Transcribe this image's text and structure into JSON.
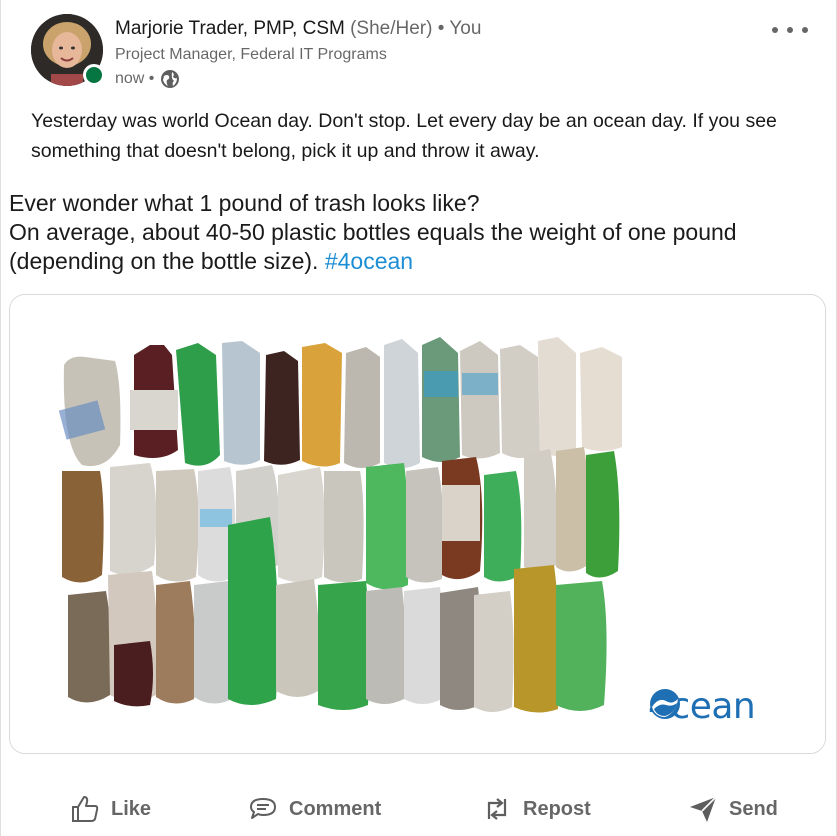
{
  "post": {
    "author": {
      "name": "Marjorie Trader, PMP, CSM",
      "pronouns": "(She/Her)",
      "degree": "• You",
      "headline": "Project Manager, Federal IT Programs",
      "time": "now •",
      "visibility_icon": "globe-icon",
      "presence_color": "#057642"
    },
    "commentary": "Yesterday was world Ocean day. Don't stop. Let every day be an ocean day. If you see something that doesn't belong, pick it up and throw it away.",
    "embedded_text": {
      "line1": "Ever wonder what 1 pound of trash looks like?",
      "line2": "On average, about 40-50 plastic bottles equals the weight of one pound",
      "line3": "(depending on the bottle size).",
      "hashtag": "#4ocean"
    },
    "image": {
      "brand_prefix": "4",
      "brand_suffix": "cean"
    },
    "actions": {
      "like": "Like",
      "comment": "Comment",
      "repost": "Repost",
      "send": "Send"
    },
    "accent_color": "#1d8ed6"
  }
}
